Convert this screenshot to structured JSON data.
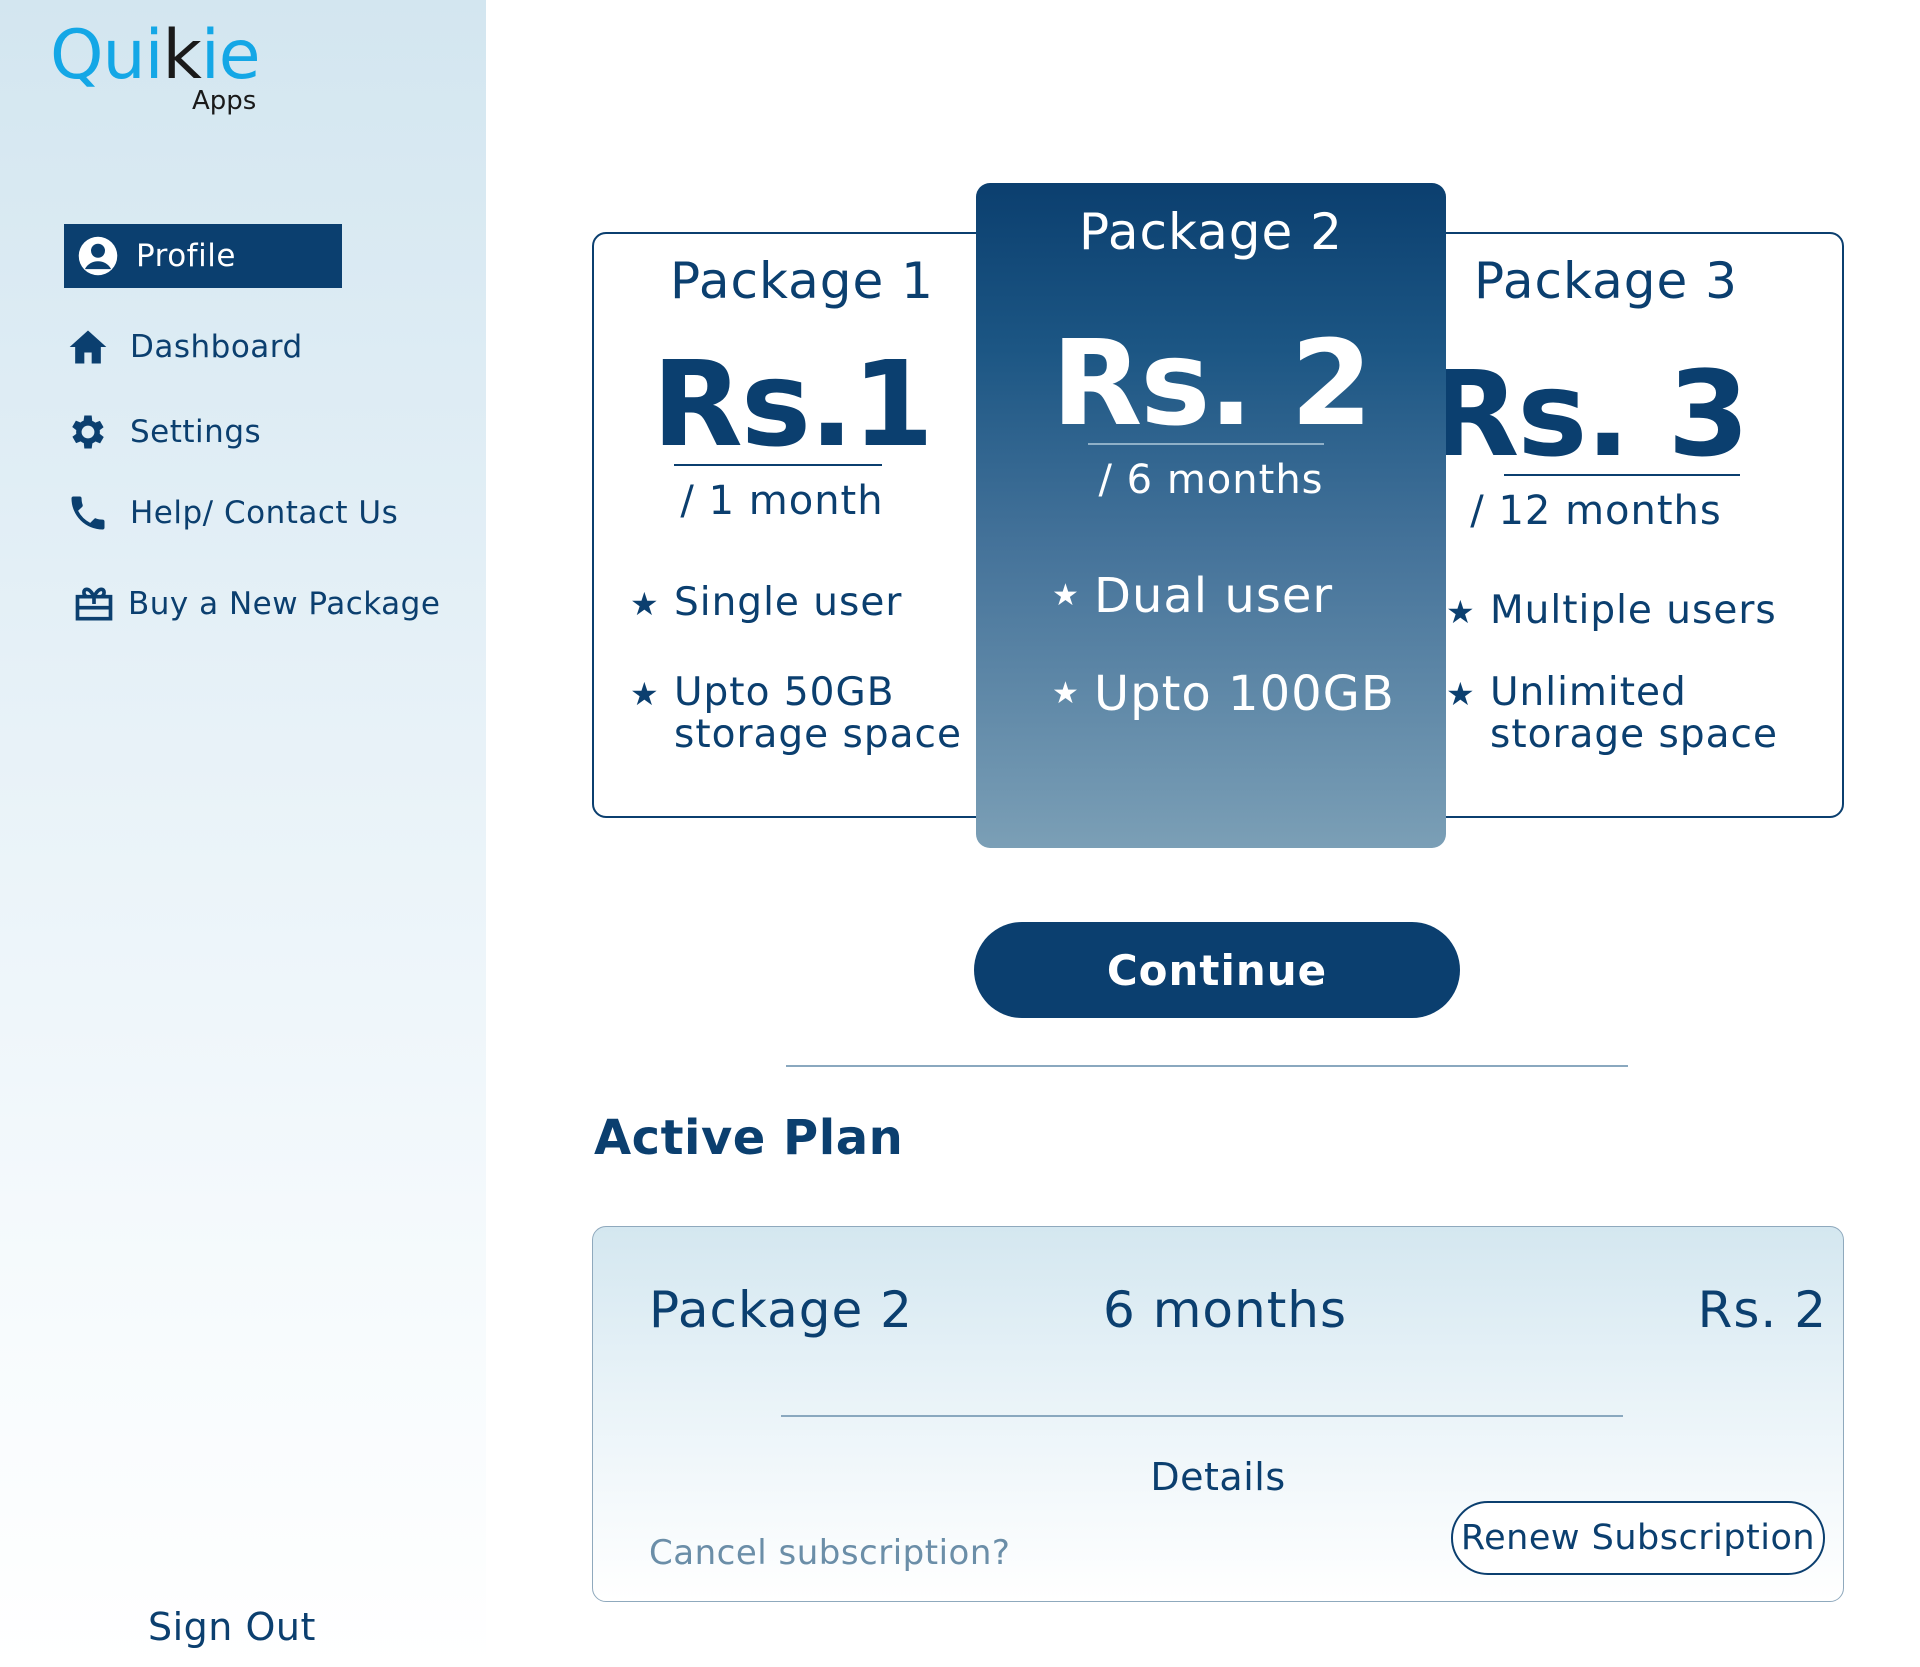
{
  "brand": {
    "name_part1": "Qui",
    "name_part2": "k",
    "name_part3": "ie",
    "sub": "Apps",
    "primary_color": "#0b3f6f",
    "accent_color": "#14a7e6"
  },
  "sidebar": {
    "items": [
      {
        "label": "Profile",
        "icon": "user-circle-icon",
        "active": true
      },
      {
        "label": "Dashboard",
        "icon": "home-icon",
        "active": false
      },
      {
        "label": "Settings",
        "icon": "gear-icon",
        "active": false
      },
      {
        "label": "Help/ Contact Us",
        "icon": "phone-icon",
        "active": false
      },
      {
        "label": "Buy a New Package",
        "icon": "gift-card-icon",
        "active": false
      }
    ],
    "sign_out": "Sign Out"
  },
  "packages": [
    {
      "title": "Package 1",
      "price": "Rs.1",
      "period": "/ 1 month",
      "features": [
        {
          "line1": "Single user",
          "line2": ""
        },
        {
          "line1": "Upto 50GB",
          "line2": "storage space"
        }
      ]
    },
    {
      "title": "Package 2",
      "price": "Rs. 2",
      "period": "/ 6 months",
      "selected": true,
      "features": [
        {
          "line1": "Dual user",
          "line2": ""
        },
        {
          "line1": "Upto 100GB",
          "line2": ""
        }
      ]
    },
    {
      "title": "Package 3",
      "price": "Rs. 3",
      "period": "/ 12 months",
      "features": [
        {
          "line1": "Multiple users",
          "line2": ""
        },
        {
          "line1": "Unlimited",
          "line2": "storage space"
        }
      ]
    }
  ],
  "star_glyph": "★",
  "continue_label": "Continue",
  "active_plan": {
    "heading": "Active Plan",
    "package": "Package 2",
    "duration": "6 months",
    "price": "Rs. 2",
    "details_label": "Details",
    "cancel_label": "Cancel subscription?",
    "renew_label": "Renew Subscription"
  }
}
